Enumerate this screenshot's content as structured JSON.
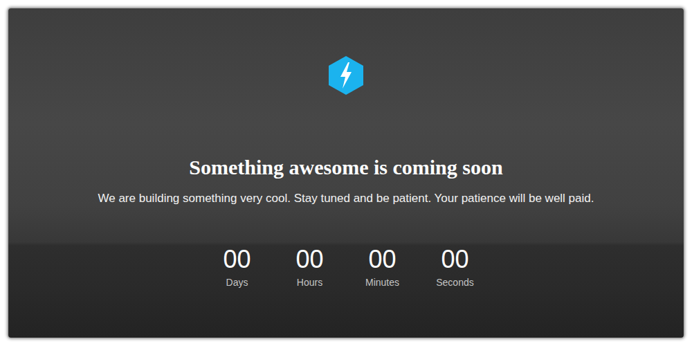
{
  "heading": "Something awesome is coming soon",
  "subheading": "We are building something very cool. Stay tuned and be patient. Your patience will be well paid.",
  "countdown": [
    {
      "value": "00",
      "label": "Days"
    },
    {
      "value": "00",
      "label": "Hours"
    },
    {
      "value": "00",
      "label": "Minutes"
    },
    {
      "value": "00",
      "label": "Seconds"
    }
  ]
}
